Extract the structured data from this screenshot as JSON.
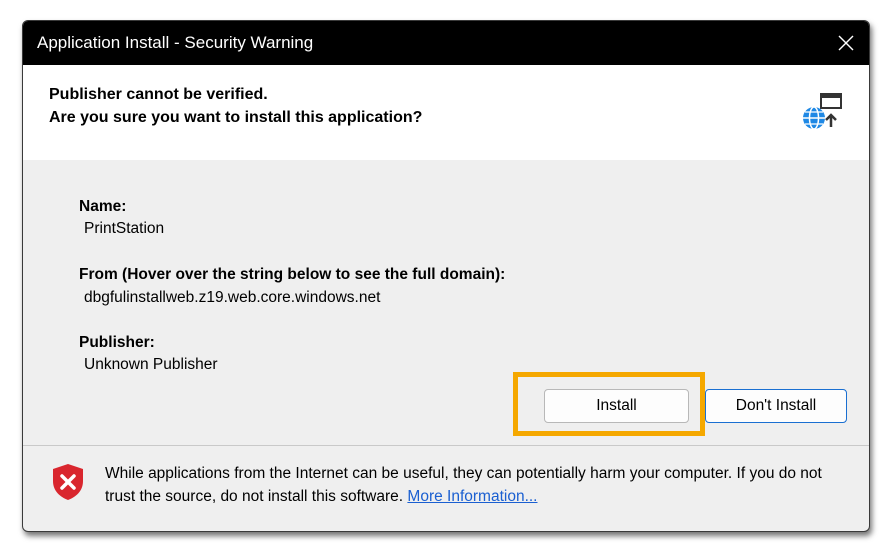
{
  "window": {
    "title": "Application Install - Security Warning",
    "close_icon": "close-icon"
  },
  "header": {
    "line1": "Publisher cannot be verified.",
    "line2": "Are you sure you want to install this application?",
    "icon": "globe-install-icon"
  },
  "details": {
    "name_label": "Name:",
    "name_value": "PrintStation",
    "from_label": "From (Hover over the string below to see the full domain):",
    "from_value": "dbgfulinstallweb.z19.web.core.windows.net",
    "publisher_label": "Publisher:",
    "publisher_value": "Unknown Publisher"
  },
  "buttons": {
    "install_label": "Install",
    "dont_install_label": "Don't Install"
  },
  "footer": {
    "warning_text": "While applications from the Internet can be useful, they can potentially harm your computer. If you do not trust the source, do not install this software.",
    "link_text": "More Information...",
    "icon": "shield-warning-icon"
  },
  "colors": {
    "highlight": "#f5a800",
    "titlebar": "#000000",
    "link": "#1a5fd1",
    "shield": "#d9262e"
  }
}
